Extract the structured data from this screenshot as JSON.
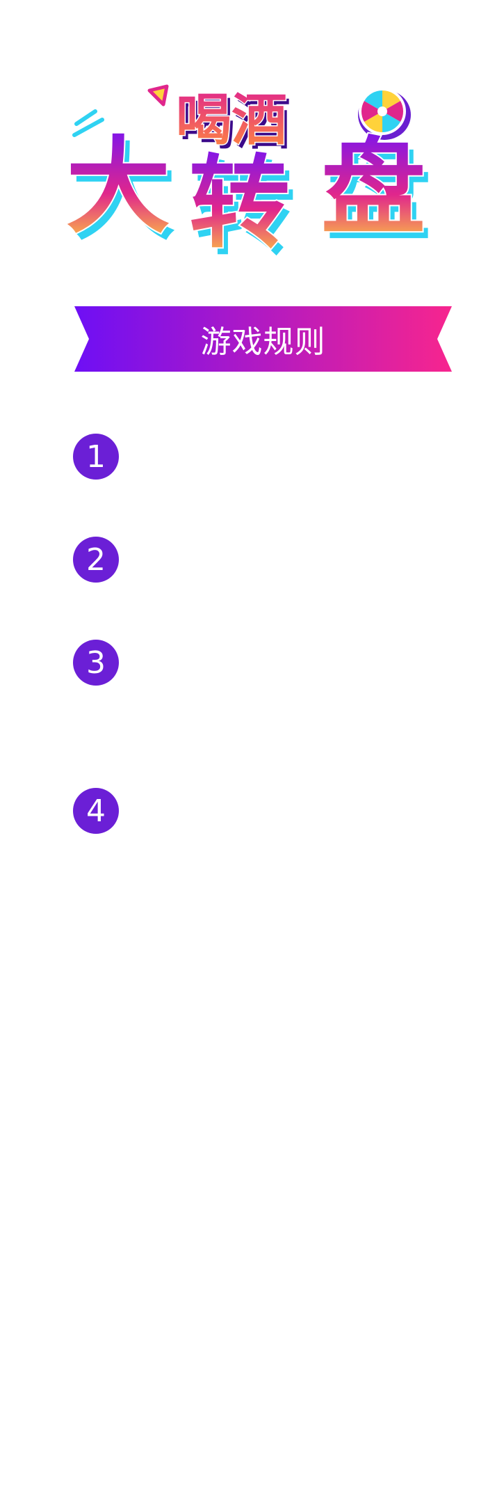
{
  "logo": {
    "line1": "喝酒",
    "line2_a": "大",
    "line2_b": "转",
    "line2_c": "盘",
    "colors": {
      "purple": "#7a14f0",
      "magenta": "#e0268c",
      "orange": "#ff8a3d",
      "yellow": "#ffd23a",
      "cyan": "#2fd2f2",
      "deep_purple": "#3c0a8a"
    }
  },
  "banner": {
    "label": "游戏规则",
    "gradient_start": "#6e0ff5",
    "gradient_end": "#f7258e"
  },
  "rules": [
    {
      "number": "1",
      "text": ""
    },
    {
      "number": "2",
      "text": ""
    },
    {
      "number": "3",
      "text": ""
    },
    {
      "number": "4",
      "text": ""
    }
  ],
  "badge_color": "#6b1fd6"
}
